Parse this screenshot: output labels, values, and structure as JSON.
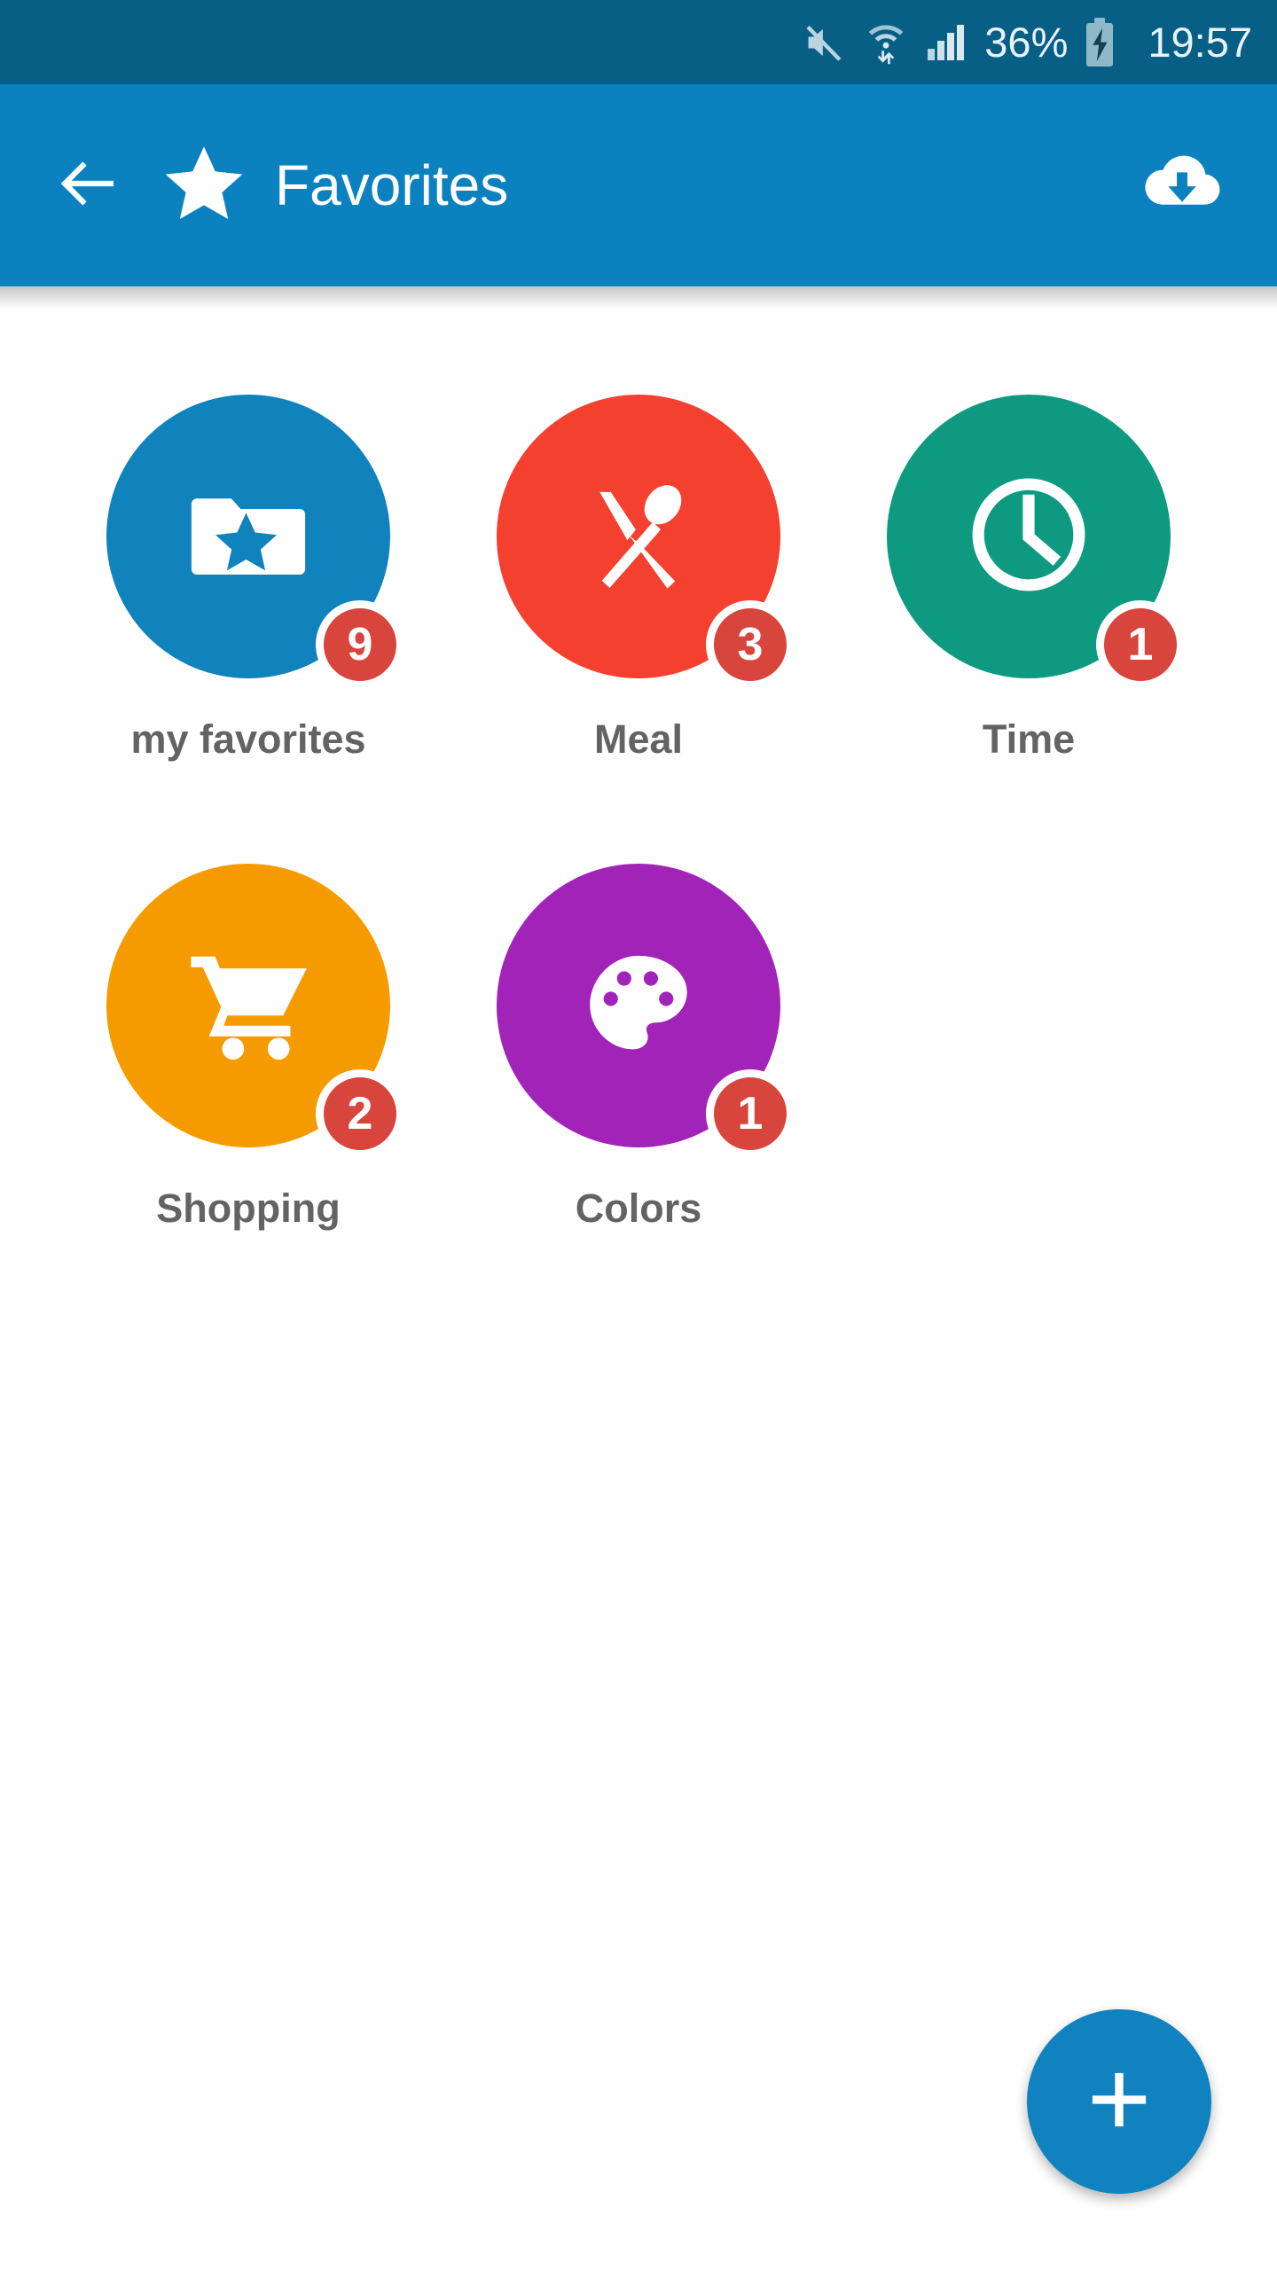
{
  "status_bar": {
    "background_color": "#075F86",
    "battery_percent": "36%",
    "clock": "19:57",
    "icons": [
      "volume-mute-icon",
      "wifi-transfer-icon",
      "cellular-signal-icon",
      "battery-charging-icon"
    ]
  },
  "app_bar": {
    "background_color": "#0B82BF",
    "back_icon": "arrow-left-icon",
    "brand_icon": "star-icon",
    "title": "Favorites",
    "action_icon": "cloud-download-icon"
  },
  "grid": {
    "items": [
      {
        "label": "my favorites",
        "badge": "9",
        "color": "#1082BC",
        "badge_color": "#D8453C",
        "icon": "folder-star-icon"
      },
      {
        "label": "Meal",
        "badge": "3",
        "color": "#F4412F",
        "badge_color": "#D8453C",
        "icon": "fork-spoon-icon"
      },
      {
        "label": "Time",
        "badge": "1",
        "color": "#0E9A81",
        "badge_color": "#D8453C",
        "icon": "clock-icon"
      },
      {
        "label": "Shopping",
        "badge": "2",
        "color": "#F59B00",
        "badge_color": "#D8453C",
        "icon": "shopping-cart-icon"
      },
      {
        "label": "Colors",
        "badge": "1",
        "color": "#A223B8",
        "badge_color": "#D8453C",
        "icon": "palette-icon"
      }
    ]
  },
  "fab": {
    "label": "+",
    "icon": "plus-icon",
    "color": "#1082BF"
  }
}
